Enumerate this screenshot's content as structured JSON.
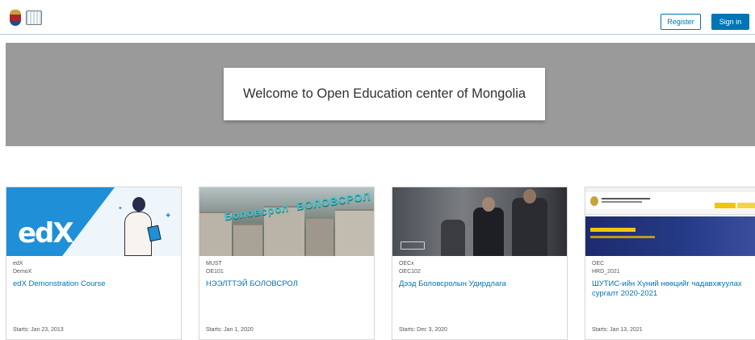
{
  "header": {
    "register_label": "Register",
    "signin_label": "Sign in"
  },
  "hero": {
    "title": "Welcome to Open Education center of Mongolia"
  },
  "courses": [
    {
      "org": "edX",
      "code": "DemoX",
      "title": "edX Demonstration Course",
      "start": "Starts: Jan 23, 2013",
      "image": "edx-logo-illustration"
    },
    {
      "org": "MUST",
      "code": "OE101",
      "title": "НЭЭЛТТЭЙ БОЛОВСРОЛ",
      "start": "Starts: Jan 1, 2020",
      "image": "city-aerial-photo"
    },
    {
      "org": "OECx",
      "code": "OEC102",
      "title": "Дээд Боловсролын Удирдлага",
      "start": "Starts: Dec 3, 2020",
      "image": "business-people-photo"
    },
    {
      "org": "OEC",
      "code": "HRD_2021",
      "title": "ШУТИС-ийн Хүний нөөцийг чадавхжуулах сургалт 2020-2021",
      "start": "Starts: Jan 13, 2021",
      "image": "website-screenshot"
    }
  ],
  "colors": {
    "accent": "#0075b4",
    "hero_bg": "#9a9a9a",
    "edx_blue": "#1f8fd8"
  }
}
